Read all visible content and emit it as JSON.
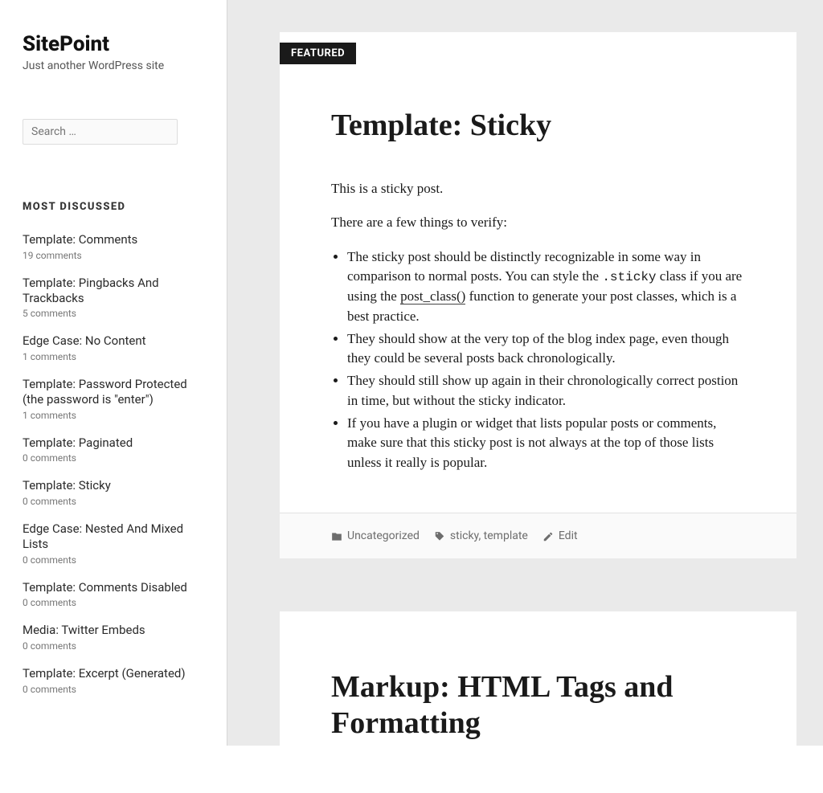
{
  "site": {
    "title": "SitePoint",
    "tagline": "Just another WordPress site"
  },
  "search": {
    "placeholder": "Search …"
  },
  "widget": {
    "title": "MOST DISCUSSED"
  },
  "most_discussed": [
    {
      "title": "Template: Comments",
      "meta": "19 comments"
    },
    {
      "title": "Template: Pingbacks And Trackbacks",
      "meta": "5 comments"
    },
    {
      "title": "Edge Case: No Content",
      "meta": "1 comments"
    },
    {
      "title": "Template: Password Protected (the password is \"enter\")",
      "meta": "1 comments"
    },
    {
      "title": "Template: Paginated",
      "meta": "0 comments"
    },
    {
      "title": "Template: Sticky",
      "meta": "0 comments"
    },
    {
      "title": "Edge Case: Nested And Mixed Lists",
      "meta": "0 comments"
    },
    {
      "title": "Template: Comments Disabled",
      "meta": "0 comments"
    },
    {
      "title": "Media: Twitter Embeds",
      "meta": "0 comments"
    },
    {
      "title": "Template: Excerpt (Generated)",
      "meta": "0 comments"
    }
  ],
  "badge": {
    "featured": "FEATURED"
  },
  "post1": {
    "title": "Template: Sticky",
    "p1": "This is a sticky post.",
    "p2": "There are a few things to verify:",
    "li1a": "The sticky post should be distinctly recognizable in some way in comparison to normal posts. You can style the ",
    "li1code": ".sticky",
    "li1b": " class if you are using the ",
    "li1link": "post_class()",
    "li1c": " function to generate your post classes, which is a best practice.",
    "li2": "They should show at the very top of the blog index page, even though they could be several posts back chronologically.",
    "li3": "They should still show up again in their chronologically correct postion in time, but without the sticky indicator.",
    "li4": "If you have a plugin or widget that lists popular posts or comments, make sure that this sticky post is not always at the top of those lists unless it really is popular.",
    "footer": {
      "category": "Uncategorized",
      "tag1": "sticky",
      "tag_sep": ", ",
      "tag2": "template",
      "edit": "Edit"
    }
  },
  "post2": {
    "title": "Markup: HTML Tags and Formatting"
  }
}
